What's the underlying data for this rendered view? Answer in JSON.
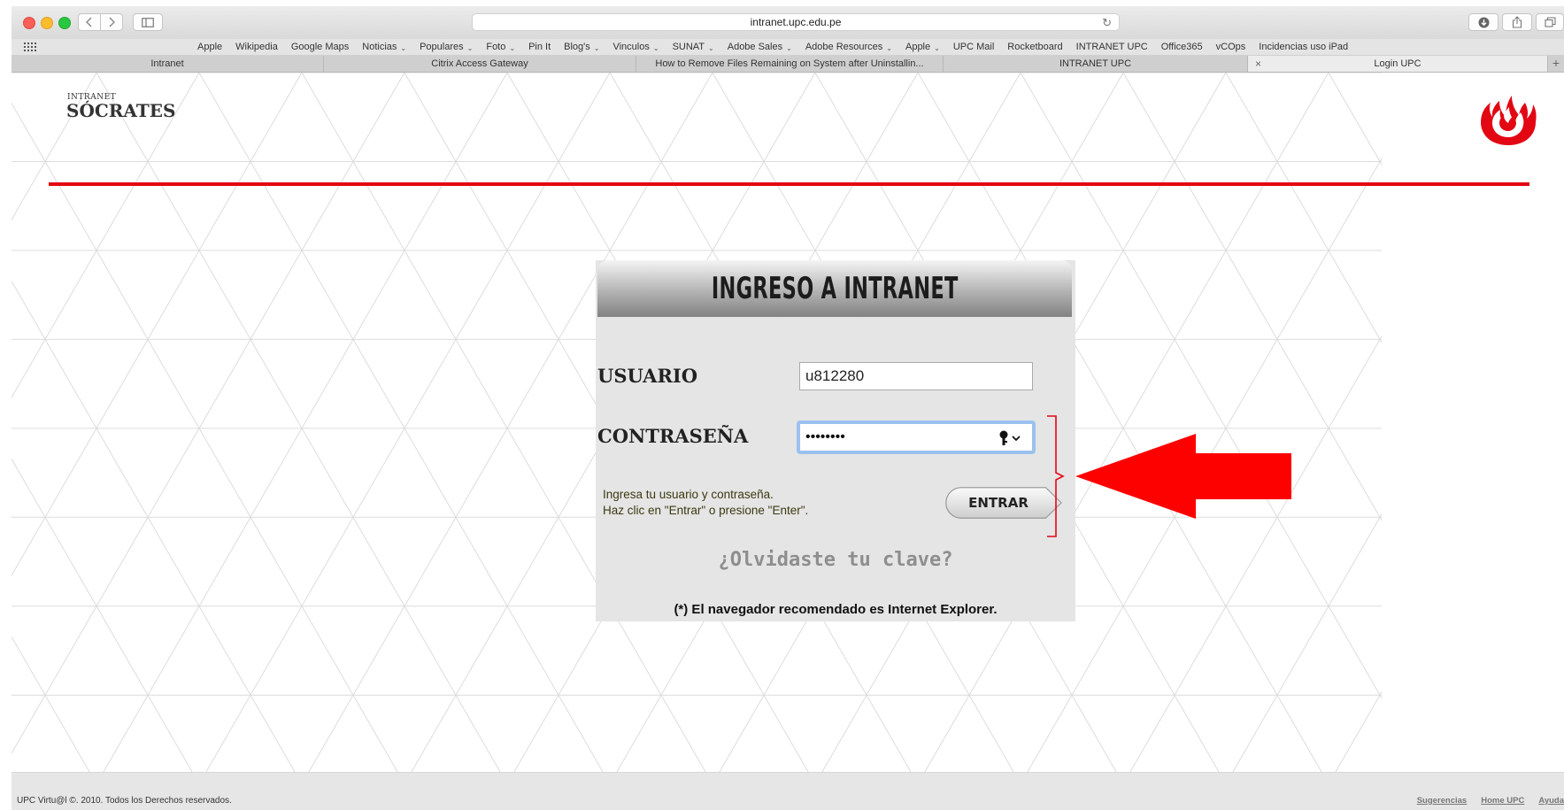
{
  "browser": {
    "url": "intranet.upc.edu.pe"
  },
  "bookmarks": [
    {
      "label": "Apple",
      "dropdown": false
    },
    {
      "label": "Wikipedia",
      "dropdown": false
    },
    {
      "label": "Google Maps",
      "dropdown": false
    },
    {
      "label": "Noticias",
      "dropdown": true
    },
    {
      "label": "Populares",
      "dropdown": true
    },
    {
      "label": "Foto",
      "dropdown": true
    },
    {
      "label": "Pin It",
      "dropdown": false
    },
    {
      "label": "Blog's",
      "dropdown": true
    },
    {
      "label": "Vinculos",
      "dropdown": true
    },
    {
      "label": "SUNAT",
      "dropdown": true
    },
    {
      "label": "Adobe Sales",
      "dropdown": true
    },
    {
      "label": "Adobe Resources",
      "dropdown": true
    },
    {
      "label": "Apple",
      "dropdown": true
    },
    {
      "label": "UPC Mail",
      "dropdown": false
    },
    {
      "label": "Rocketboard",
      "dropdown": false
    },
    {
      "label": "INTRANET UPC",
      "dropdown": false
    },
    {
      "label": "Office365",
      "dropdown": false
    },
    {
      "label": "vCOps",
      "dropdown": false
    },
    {
      "label": "Incidencias uso iPad",
      "dropdown": false
    }
  ],
  "tabs": [
    {
      "label": "Intranet",
      "active": false
    },
    {
      "label": "Citrix Access Gateway",
      "active": false
    },
    {
      "label": "How to Remove Files Remaining on System after Uninstallin...",
      "active": false
    },
    {
      "label": "INTRANET UPC",
      "active": false
    },
    {
      "label": "Login UPC",
      "active": true
    }
  ],
  "site": {
    "logo_small": "INTRANET",
    "logo_main": "SÓCRATES",
    "brand_red": "#e30613"
  },
  "login": {
    "title": "INGRESO A INTRANET",
    "usuario_label": "USUARIO",
    "usuario_value": "u812280",
    "contrasena_label": "CONTRASEÑA",
    "password_value": "••••••••",
    "hint_line1": "Ingresa tu usuario y contraseña.",
    "hint_line2": "Haz clic en \"Entrar\" o presione \"Enter\".",
    "entrar_label": "ENTRAR",
    "forgot_label": "¿Olvidaste tu clave?",
    "browser_note": "(*) El navegador recomendado es Internet Explorer."
  },
  "footer": {
    "copyright": "UPC Virtu@l ©. 2010. Todos los Derechos reservados.",
    "links": [
      "Sugerencias",
      "Home UPC",
      "Ayuda"
    ]
  }
}
